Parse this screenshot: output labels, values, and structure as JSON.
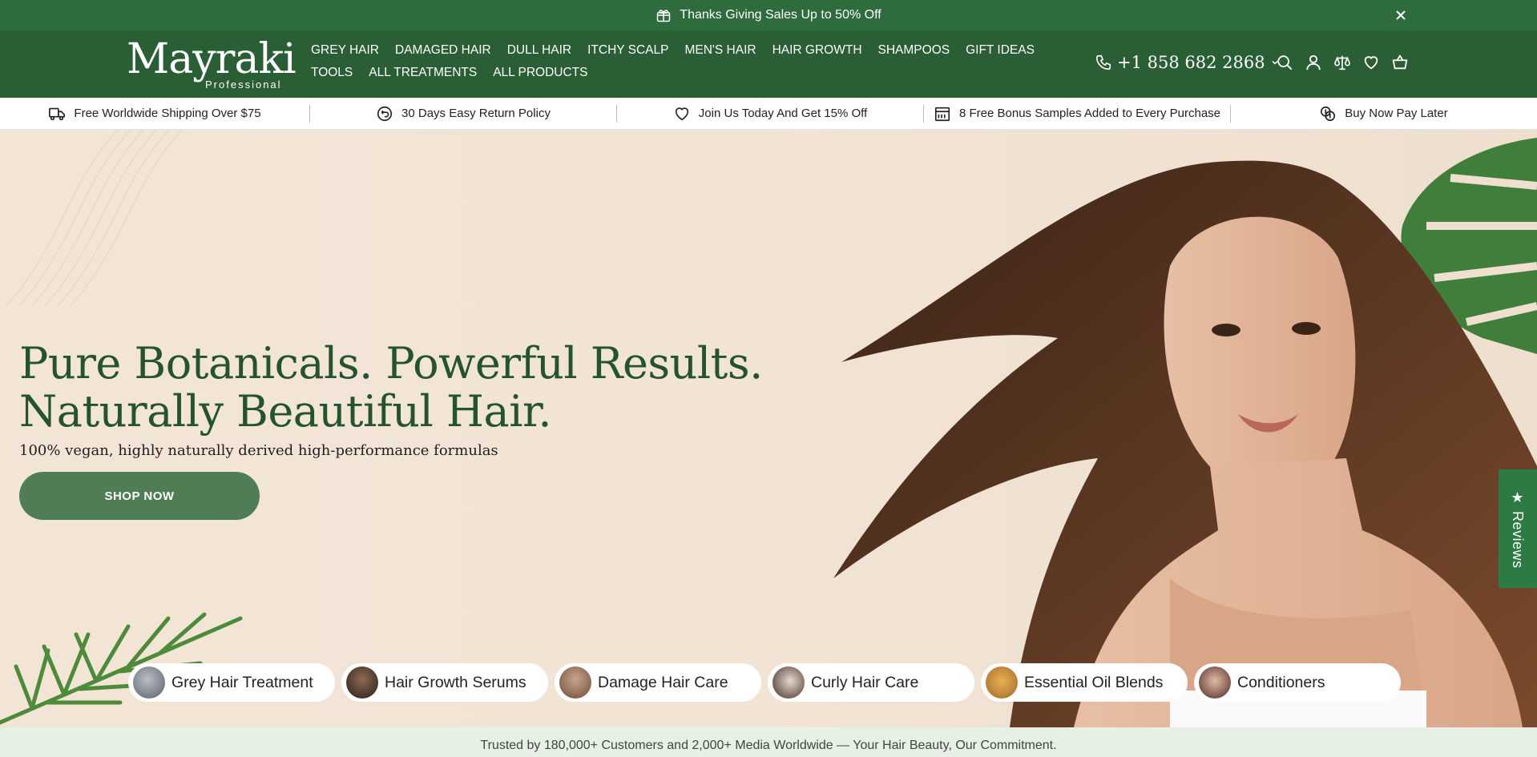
{
  "announcement": {
    "text": "Thanks Giving Sales Up to 50% Off",
    "icon": "gift-icon"
  },
  "brand": {
    "name": "Mayraki",
    "tagline": "Professional"
  },
  "nav": {
    "items": [
      "GREY HAIR",
      "DAMAGED HAIR",
      "DULL HAIR",
      "ITCHY SCALP",
      "MEN'S HAIR",
      "HAIR GROWTH",
      "SHAMPOOS",
      "GIFT IDEAS",
      "TOOLS",
      "ALL TREATMENTS",
      "ALL PRODUCTS"
    ]
  },
  "contact": {
    "phone": "+1 858 682 2868"
  },
  "header_icons": [
    "search-icon",
    "account-icon",
    "compare-icon",
    "wishlist-icon",
    "cart-icon"
  ],
  "perks": [
    {
      "text": "Free Worldwide Shipping Over $75",
      "icon": "truck-icon"
    },
    {
      "text": "30 Days Easy Return Policy",
      "icon": "return-icon"
    },
    {
      "text": "Join Us Today And Get 15% Off",
      "icon": "heart-icon"
    },
    {
      "text": "8 Free Bonus Samples Added to Every Purchase",
      "icon": "gift-box-icon"
    },
    {
      "text": "Buy Now Pay Later",
      "icon": "coins-icon"
    }
  ],
  "hero": {
    "headline_line1": "Pure Botanicals. Powerful Results.",
    "headline_line2": "Naturally Beautiful Hair.",
    "subline": "100% vegan, highly naturally derived high-performance formulas",
    "cta": "SHOP NOW"
  },
  "reviews_tab": "★ Reviews",
  "categories": [
    "Grey Hair Treatment",
    "Hair Growth Serums",
    "Damage Hair Care",
    "Curly Hair Care",
    "Essential Oil Blends",
    "Conditioners"
  ],
  "trust_text": "Trusted by 180,000+ Customers and 2,000+ Media Worldwide — Your Hair Beauty, Our Commitment.",
  "colors": {
    "brand_green": "#2a5e34",
    "announce_green": "#2e6b3d",
    "cta_green": "#4e7d56",
    "hero_bg": "#f3e6d8"
  }
}
